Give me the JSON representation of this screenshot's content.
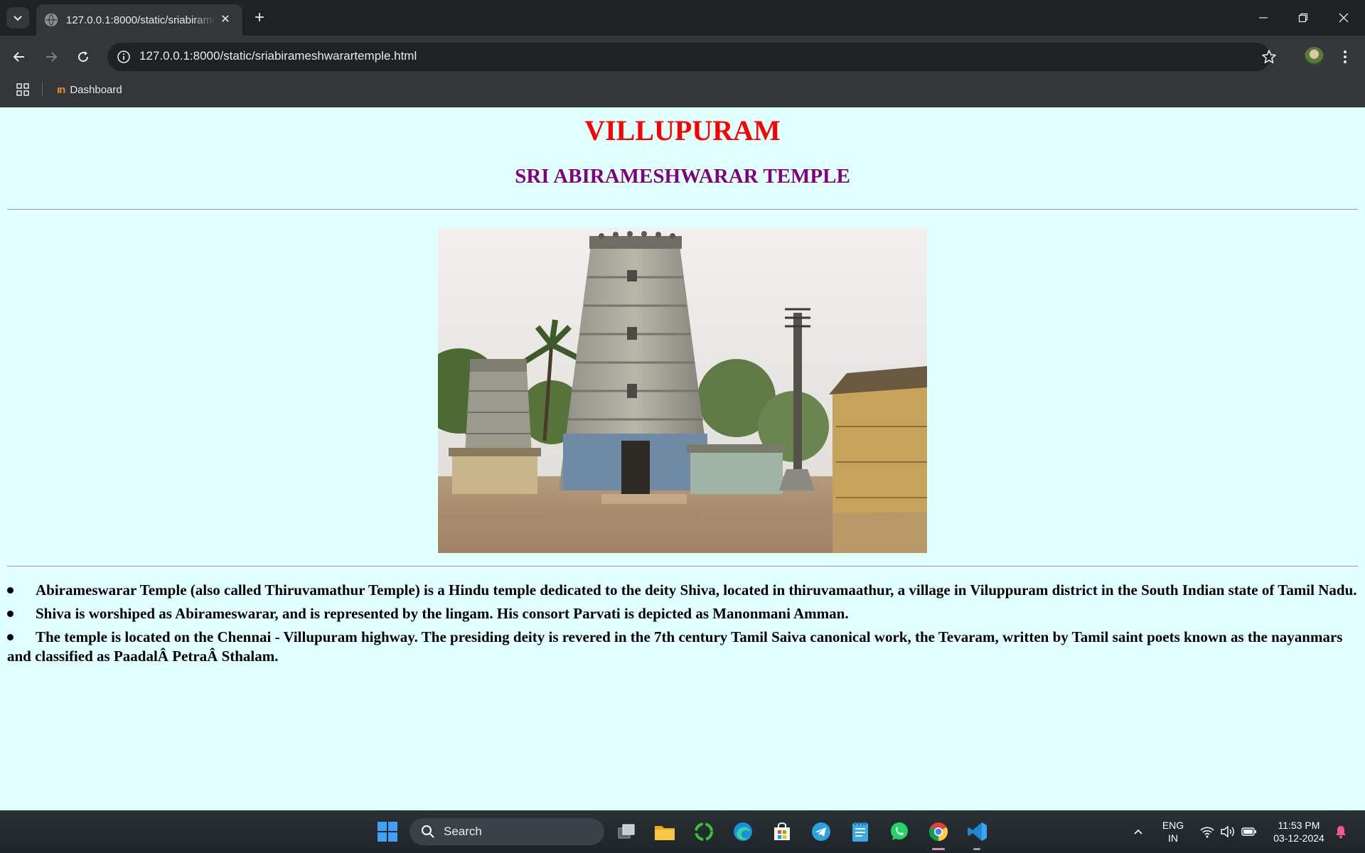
{
  "browser": {
    "tab_title": "127.0.0.1:8000/static/sriabirameshwarartemple.html",
    "url": "127.0.0.1:8000/static/sriabirameshwarartemple.html",
    "bookmarks": [
      {
        "label": "Dashboard"
      }
    ]
  },
  "page": {
    "title": "VILLUPURAM",
    "subtitle": "SRI ABIRAMESHWARAR TEMPLE",
    "title_color": "#ff0000",
    "subtitle_color": "#800080",
    "background_color": "#e0ffff",
    "facts": [
      "Abirameswarar Temple (also called Thiruvamathur Temple) is a Hindu temple dedicated to the deity Shiva, located in thiruvamaathur, a village in Viluppuram district in the South Indian state of Tamil Nadu.",
      "Shiva is worshiped as Abirameswarar, and is represented by the lingam. His consort Parvati is depicted as Manonmani Amman.",
      "The temple is located on the Chennai - Villupuram highway. The presiding deity is revered in the 7th century Tamil Saiva canonical work, the Tevaram, written by Tamil saint poets known as the nayanmars and classified as PaadalÂ PetraÂ Sthalam."
    ]
  },
  "taskbar": {
    "search_label": "Search",
    "language_top": "ENG",
    "language_bottom": "IN",
    "time": "11:53 PM",
    "date": "03-12-2024",
    "apps": [
      "windows-start",
      "task-view",
      "file-explorer",
      "sync-app",
      "edge",
      "store",
      "telegram",
      "notepad",
      "whatsapp",
      "chrome",
      "vscode"
    ]
  }
}
